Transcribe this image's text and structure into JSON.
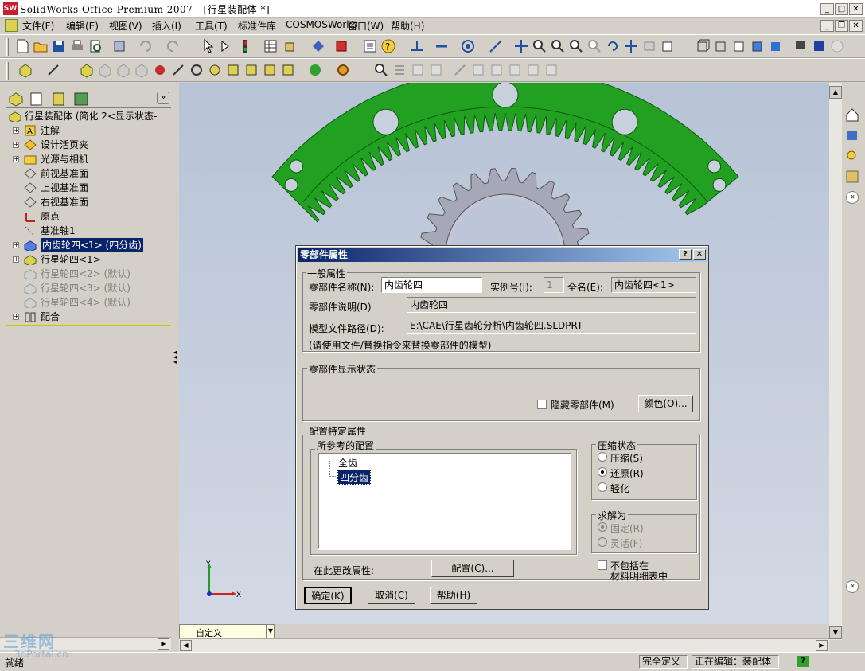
{
  "app": {
    "title": "SolidWorks Office Premium 2007 - [行星装配体 *]",
    "logo": "SW"
  },
  "menu": [
    "文件(F)",
    "编辑(E)",
    "视图(V)",
    "插入(I)",
    "工具(T)",
    "标准件库",
    "COSMOSWorks",
    "窗口(W)",
    "帮助(H)"
  ],
  "tree": {
    "root": "行星装配体 (简化 2<显示状态-",
    "items": [
      {
        "pm": "+",
        "label": "注解",
        "icon": "annotation-icon",
        "state": "normal"
      },
      {
        "pm": "+",
        "label": "设计活页夹",
        "icon": "design-binder-icon",
        "state": "normal"
      },
      {
        "pm": "+",
        "label": "光源与相机",
        "icon": "lights-camera-icon",
        "state": "normal"
      },
      {
        "pm": "",
        "label": "前视基准面",
        "icon": "plane-icon",
        "state": "normal"
      },
      {
        "pm": "",
        "label": "上视基准面",
        "icon": "plane-icon",
        "state": "normal"
      },
      {
        "pm": "",
        "label": "右视基准面",
        "icon": "plane-icon",
        "state": "normal"
      },
      {
        "pm": "",
        "label": "原点",
        "icon": "origin-icon",
        "state": "normal"
      },
      {
        "pm": "",
        "label": "基准轴1",
        "icon": "axis-icon",
        "state": "normal"
      },
      {
        "pm": "+",
        "label": "内齿轮四<1> (四分齿)",
        "icon": "part-icon",
        "state": "selected"
      },
      {
        "pm": "+",
        "label": "行星轮四<1>",
        "icon": "part-icon",
        "state": "normal"
      },
      {
        "pm": "",
        "label": "行星轮四<2> (默认)",
        "icon": "part-icon",
        "state": "dim"
      },
      {
        "pm": "",
        "label": "行星轮四<3> (默认)",
        "icon": "part-icon",
        "state": "dim"
      },
      {
        "pm": "",
        "label": "行星轮四<4> (默认)",
        "icon": "part-icon",
        "state": "dim"
      },
      {
        "pm": "+",
        "label": "配合",
        "icon": "mates-icon",
        "state": "normal"
      }
    ]
  },
  "dialog": {
    "title": "零部件属性",
    "help_btn": "?",
    "close_btn": "✕",
    "general": {
      "group": "一般属性",
      "name_label": "零部件名称(N):",
      "name_value": "内齿轮四",
      "instance_label": "实例号(I):",
      "instance_value": "1",
      "fullname_label": "全名(E):",
      "fullname_value": "内齿轮四<1>",
      "desc_label": "零部件说明(D)",
      "desc_value": "内齿轮四",
      "path_label": "模型文件路径(D):",
      "path_value": "E:\\CAE\\行星齿轮分析\\内齿轮四.SLDPRT",
      "note": "(请使用文件/替换指令来替换零部件的模型)"
    },
    "display": {
      "group": "零部件显示状态",
      "hide_label": "隐藏零部件(M)",
      "color_btn": "颜色(O)..."
    },
    "config": {
      "group": "配置特定属性",
      "ref_group": "所参考的配置",
      "configs": [
        "全齿",
        "四分齿"
      ],
      "selected": "四分齿",
      "suppress_group": "压缩状态",
      "suppress_opts": [
        "压缩(S)",
        "还原(R)",
        "轻化"
      ],
      "suppress_selected": "还原(R)",
      "solve_group": "求解为",
      "solve_opts": [
        "固定(R)",
        "灵活(F)"
      ],
      "solve_selected": "固定(R)",
      "change_label": "在此更改属性:",
      "config_btn": "配置(C)...",
      "exclude_label1": "不包括在",
      "exclude_label2": "材料明细表中"
    },
    "ok": "确定(K)",
    "cancel": "取消(C)",
    "help": "帮助(H)"
  },
  "viewport": {
    "axis_x": "X",
    "axis_y": "Y"
  },
  "bottom_dropdown": "自定义",
  "status": {
    "left": "就绪",
    "defined": "完全定义",
    "editing": "正在编辑：装配体",
    "help_icon": "?"
  },
  "watermark": {
    "line1": "三维网",
    "line2": "3dPortal.cn"
  },
  "colors": {
    "gear_green": "#22a021",
    "gear_gray": "#a6a8b8",
    "title_blue": "#0a246a"
  }
}
